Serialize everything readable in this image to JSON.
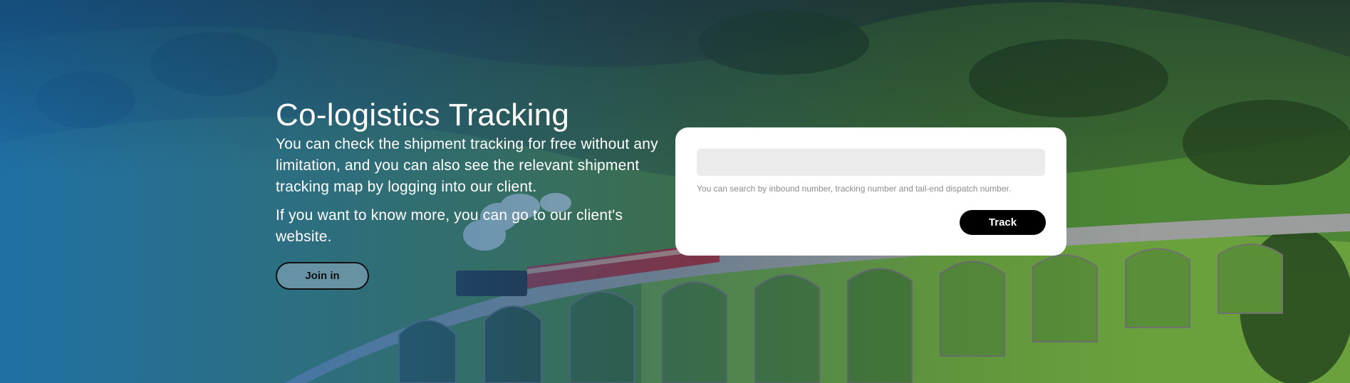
{
  "hero": {
    "title": "Co-logistics Tracking",
    "description_1": "You can check the shipment tracking for free without any limitation, and you can also see the relevant shipment tracking map by logging into our client.",
    "description_2": "If you want to know more, you can go to our client's website.",
    "join_label": "Join in",
    "background": "train-on-viaduct-photo"
  },
  "tracking": {
    "input_value": "",
    "input_placeholder": "",
    "hint": "You can search by inbound number, tracking number and tail-end dispatch number.",
    "track_label": "Track"
  },
  "colors": {
    "button_dark": "#000000",
    "input_bg": "#ebebeb",
    "hint_text": "#8c8c8c",
    "overlay_blue": "#186cb8"
  }
}
